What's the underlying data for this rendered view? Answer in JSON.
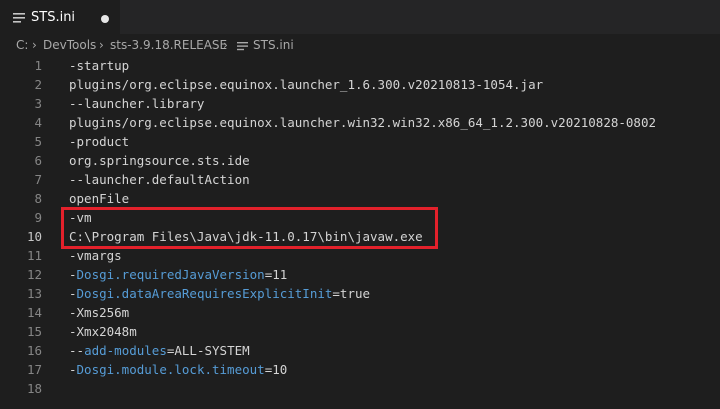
{
  "tab": {
    "title": "STS.ini",
    "modified": true
  },
  "breadcrumb": {
    "items": [
      "C:",
      "DevTools",
      "sts-3.9.18.RELEASE",
      "STS.ini"
    ]
  },
  "editor": {
    "active_line": 10,
    "lines": [
      {
        "n": "1",
        "text": "-startup"
      },
      {
        "n": "2",
        "text": "plugins/org.eclipse.equinox.launcher_1.6.300.v20210813-1054.jar"
      },
      {
        "n": "3",
        "text": "--launcher.library"
      },
      {
        "n": "4",
        "text": "plugins/org.eclipse.equinox.launcher.win32.win32.x86_64_1.2.300.v20210828-0802"
      },
      {
        "n": "5",
        "text": "-product"
      },
      {
        "n": "6",
        "text": "org.springsource.sts.ide"
      },
      {
        "n": "7",
        "text": "--launcher.defaultAction"
      },
      {
        "n": "8",
        "text": "openFile"
      },
      {
        "n": "9",
        "text": "-vm"
      },
      {
        "n": "10",
        "text": "C:\\Program Files\\Java\\jdk-11.0.17\\bin\\javaw.exe"
      },
      {
        "n": "11",
        "text": "-vmargs"
      },
      {
        "n": "12",
        "prefix": "-",
        "key": "Dosgi.requiredJavaVersion",
        "value": "=11"
      },
      {
        "n": "13",
        "prefix": "-",
        "key": "Dosgi.dataAreaRequiresExplicitInit",
        "value": "=true"
      },
      {
        "n": "14",
        "text": "-Xms256m"
      },
      {
        "n": "15",
        "text": "-Xmx2048m"
      },
      {
        "n": "16",
        "prefix": "--",
        "key": "add-modules",
        "value": "=ALL-SYSTEM"
      },
      {
        "n": "17",
        "prefix": "-",
        "key": "Dosgi.module.lock.timeout",
        "value": "=10"
      },
      {
        "n": "18",
        "text": ""
      }
    ]
  },
  "colors": {
    "background": "#1e1e1e",
    "key": "#569cd6",
    "text": "#d4d4d4",
    "highlight_border": "#e3212b"
  }
}
